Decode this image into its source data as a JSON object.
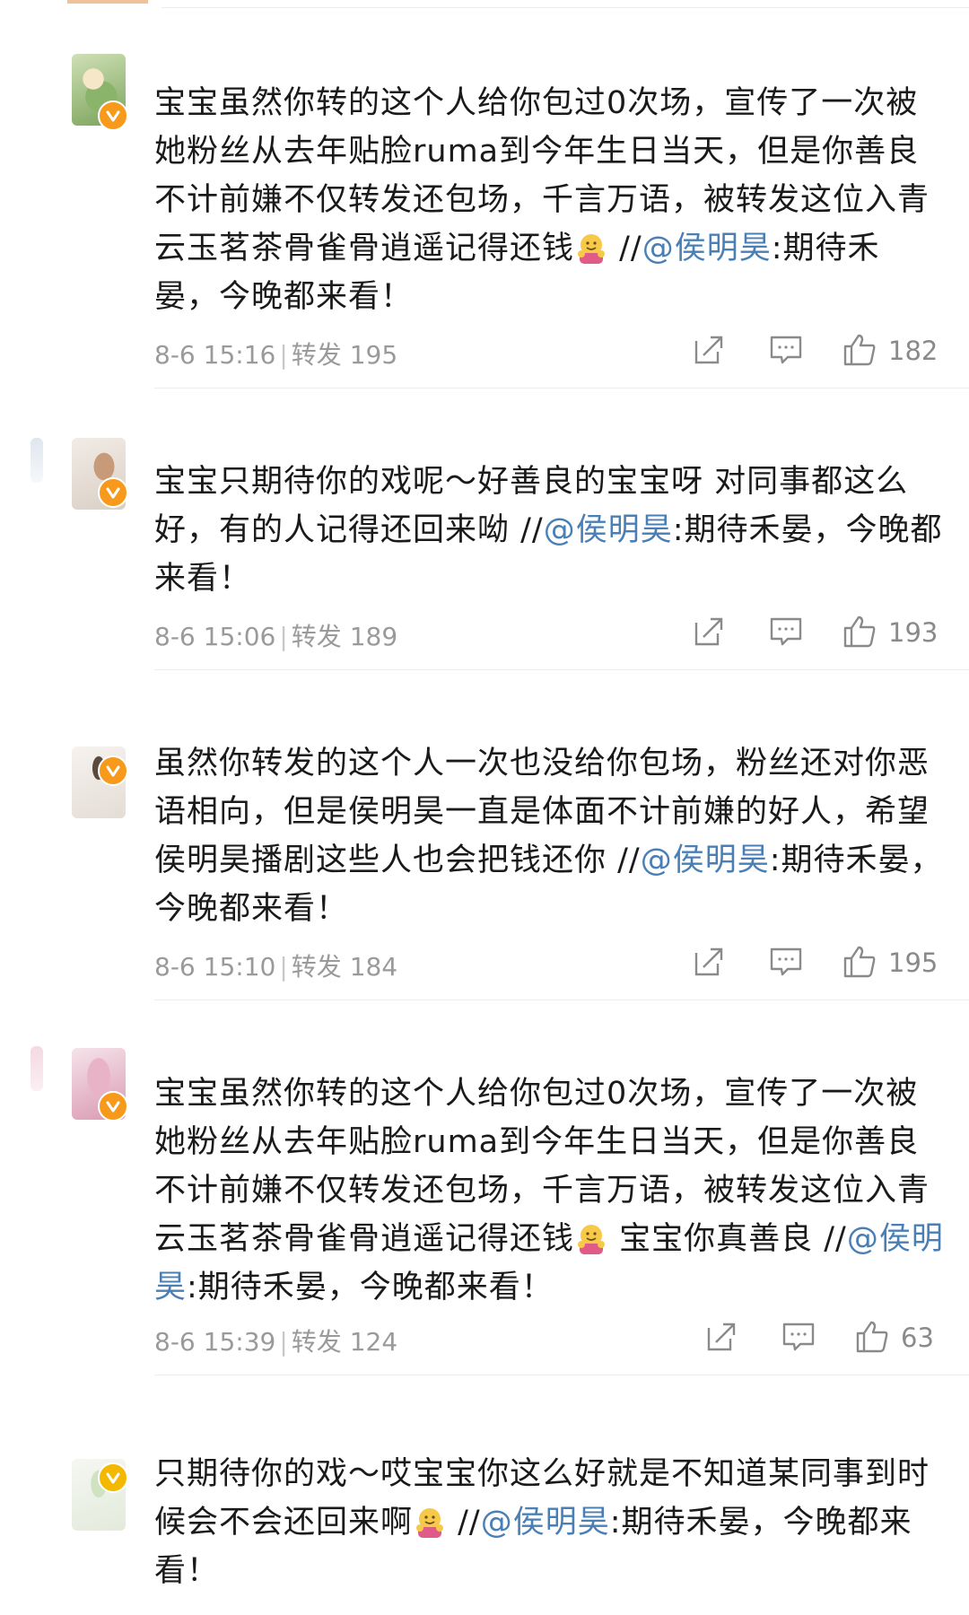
{
  "comments": [
    {
      "text_before": "宝宝虽然你转的这个人给你包过0次场，宣传了一次被她粉丝从去年贴脸ruma到今年生日当天，但是你善良不计前嫌不仅转发还包场，千言万语，被转发这位入青云玉茗茶骨雀骨逍遥记得还钱",
      "text_mid": " //",
      "mention": "@侯明昊",
      "text_after": ":期待禾晏，今晚都来看！",
      "time": "8-6 15:16",
      "repost_label": "转发",
      "repost_count": "195",
      "like_count": "182"
    },
    {
      "text_before": "宝宝只期待你的戏呢～好善良的宝宝呀 对同事都这么好，有的人记得还回来呦",
      "text_mid": " //",
      "mention": "@侯明昊",
      "text_after": ":期待禾晏，今晚都来看！",
      "time": "8-6 15:06",
      "repost_label": "转发",
      "repost_count": "189",
      "like_count": "193"
    },
    {
      "text_before": "虽然你转发的这个人一次也没给你包场，粉丝还对你恶语相向，但是侯明昊一直是体面不计前嫌的好人，希望侯明昊播剧这些人也会把钱还你",
      "text_mid": " //",
      "mention": "@侯明昊",
      "text_after": ":期待禾晏，今晚都来看！",
      "time": "8-6 15:10",
      "repost_label": "转发",
      "repost_count": "184",
      "like_count": "195"
    },
    {
      "text_before": "宝宝虽然你转的这个人给你包过0次场，宣传了一次被她粉丝从去年贴脸ruma到今年生日当天，但是你善良不计前嫌不仅转发还包场，千言万语，被转发这位入青云玉茗茶骨雀骨逍遥记得还钱",
      "text_mid": " 宝宝你真善良 //",
      "mention": "@侯明昊",
      "text_after": ":期待禾晏，今晚都来看！",
      "time": "8-6 15:39",
      "repost_label": "转发",
      "repost_count": "124",
      "like_count": "63"
    },
    {
      "text_before": "只期待你的戏～哎宝宝你这么好就是不知道某同事到时候会不会还回来啊",
      "text_mid": " //",
      "mention": "@侯明昊",
      "text_after": ":期待禾晏，今晚都来看！"
    }
  ],
  "icons": {
    "share": "share-icon",
    "comment": "comment-icon",
    "like": "thumbs-up-icon",
    "verified": "verified-badge-icon",
    "emoji": "hug-emoji-icon"
  },
  "colors": {
    "mention": "#4a7fb5",
    "text": "#1a1a1a",
    "meta": "#9a9a9a",
    "badge": "#f79a1c"
  }
}
